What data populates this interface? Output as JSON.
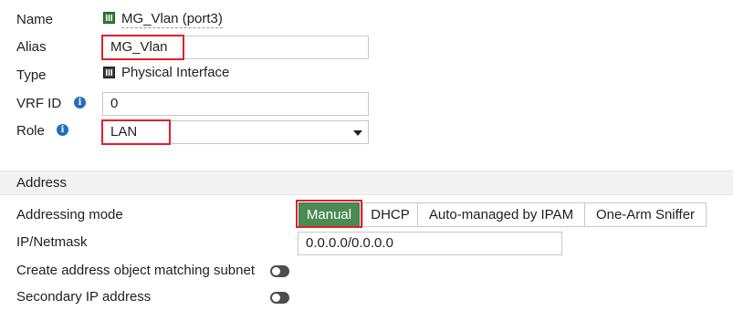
{
  "name": {
    "label": "Name",
    "value": "MG_Vlan (port3)",
    "icon": "port-interface-icon"
  },
  "alias": {
    "label": "Alias",
    "value": "MG_Vlan"
  },
  "type": {
    "label": "Type",
    "value": "Physical Interface",
    "icon": "physical-interface-icon"
  },
  "vrf": {
    "label": "VRF ID",
    "value": "0",
    "info_icon": "info-icon"
  },
  "role": {
    "label": "Role",
    "value": "LAN",
    "info_icon": "info-icon",
    "dropdown_icon": "caret-down-icon"
  },
  "address_section": {
    "title": "Address"
  },
  "addressing_mode": {
    "label": "Addressing mode",
    "options": [
      "Manual",
      "DHCP",
      "Auto-managed by IPAM",
      "One-Arm Sniffer"
    ],
    "selected": "Manual"
  },
  "ip_netmask": {
    "label": "IP/Netmask",
    "value": "0.0.0.0/0.0.0.0"
  },
  "create_address_object": {
    "label": "Create address object matching subnet",
    "enabled": false
  },
  "secondary_ip": {
    "label": "Secondary IP address",
    "enabled": false
  },
  "colors": {
    "active_segment": "#4a8a54",
    "highlight_box": "#e0202a",
    "info_icon": "#1e6fbf",
    "toggle_off": "#4d4d4d"
  }
}
